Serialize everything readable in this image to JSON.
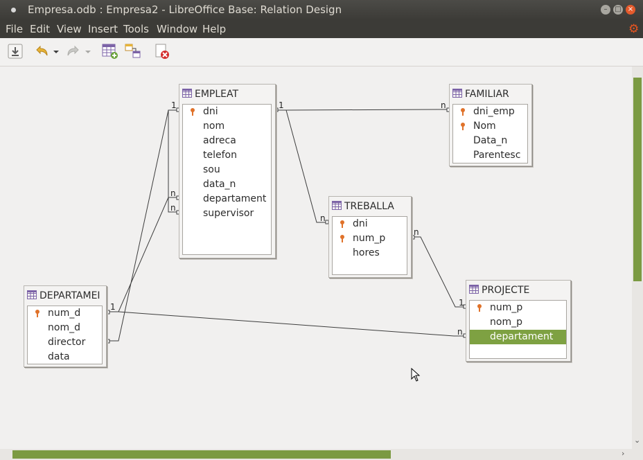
{
  "window": {
    "title": "Empresa.odb : Empresa2 - LibreOffice Base: Relation Design"
  },
  "menu": [
    "File",
    "Edit",
    "View",
    "Insert",
    "Tools",
    "Window",
    "Help"
  ],
  "toolbar": [
    "save-icon",
    "undo-icon",
    "undo-dropdown-icon",
    "redo-icon",
    "redo-dropdown-icon",
    "add-tables-icon",
    "new-relation-icon",
    "delete-icon"
  ],
  "tables": {
    "empleat": {
      "name": "EMPLEAT",
      "fields": [
        {
          "name": "dni",
          "key": true
        },
        {
          "name": "nom",
          "key": false
        },
        {
          "name": "adreca",
          "key": false
        },
        {
          "name": "telefon",
          "key": false
        },
        {
          "name": "sou",
          "key": false
        },
        {
          "name": "data_n",
          "key": false
        },
        {
          "name": "departament",
          "key": false
        },
        {
          "name": "supervisor",
          "key": false
        }
      ]
    },
    "familiar": {
      "name": "FAMILIAR",
      "fields": [
        {
          "name": "dni_emp",
          "key": true
        },
        {
          "name": "Nom",
          "key": true
        },
        {
          "name": "Data_n",
          "key": false
        },
        {
          "name": "Parentesc",
          "key": false
        }
      ]
    },
    "treballa": {
      "name": "TREBALLA",
      "fields": [
        {
          "name": "dni",
          "key": true
        },
        {
          "name": "num_p",
          "key": true
        },
        {
          "name": "hores",
          "key": false
        }
      ]
    },
    "projecte": {
      "name": "PROJECTE",
      "fields": [
        {
          "name": "num_p",
          "key": true
        },
        {
          "name": "nom_p",
          "key": false
        },
        {
          "name": "departament",
          "key": false,
          "selected": true
        }
      ]
    },
    "departament": {
      "name": "DEPARTAMEI",
      "fields": [
        {
          "name": "num_d",
          "key": true
        },
        {
          "name": "nom_d",
          "key": false
        },
        {
          "name": "director",
          "key": false
        },
        {
          "name": "data",
          "key": false
        }
      ]
    }
  },
  "relations": [
    {
      "from": "EMPLEAT.dni",
      "to": "FAMILIAR.dni_emp",
      "from_card": "1",
      "to_card": "n"
    },
    {
      "from": "EMPLEAT.dni",
      "to": "TREBALLA.dni",
      "from_card": "1",
      "to_card": "n"
    },
    {
      "from": "TREBALLA.num_p",
      "to": "PROJECTE.num_p",
      "from_card": "n",
      "to_card": "1"
    },
    {
      "from": "DEPARTAMEI.num_d",
      "to": "PROJECTE.departament",
      "from_card": "1",
      "to_card": "n"
    },
    {
      "from": "DEPARTAMEI.num_d",
      "to": "EMPLEAT.departament",
      "from_card": "1",
      "to_card": "n"
    },
    {
      "from": "EMPLEAT.dni",
      "to": "DEPARTAMEI.director",
      "from_card": "1",
      "to_card": ""
    },
    {
      "from": "EMPLEAT.supervisor",
      "to": "EMPLEAT.dni",
      "from_card": "n",
      "to_card": "1"
    }
  ]
}
